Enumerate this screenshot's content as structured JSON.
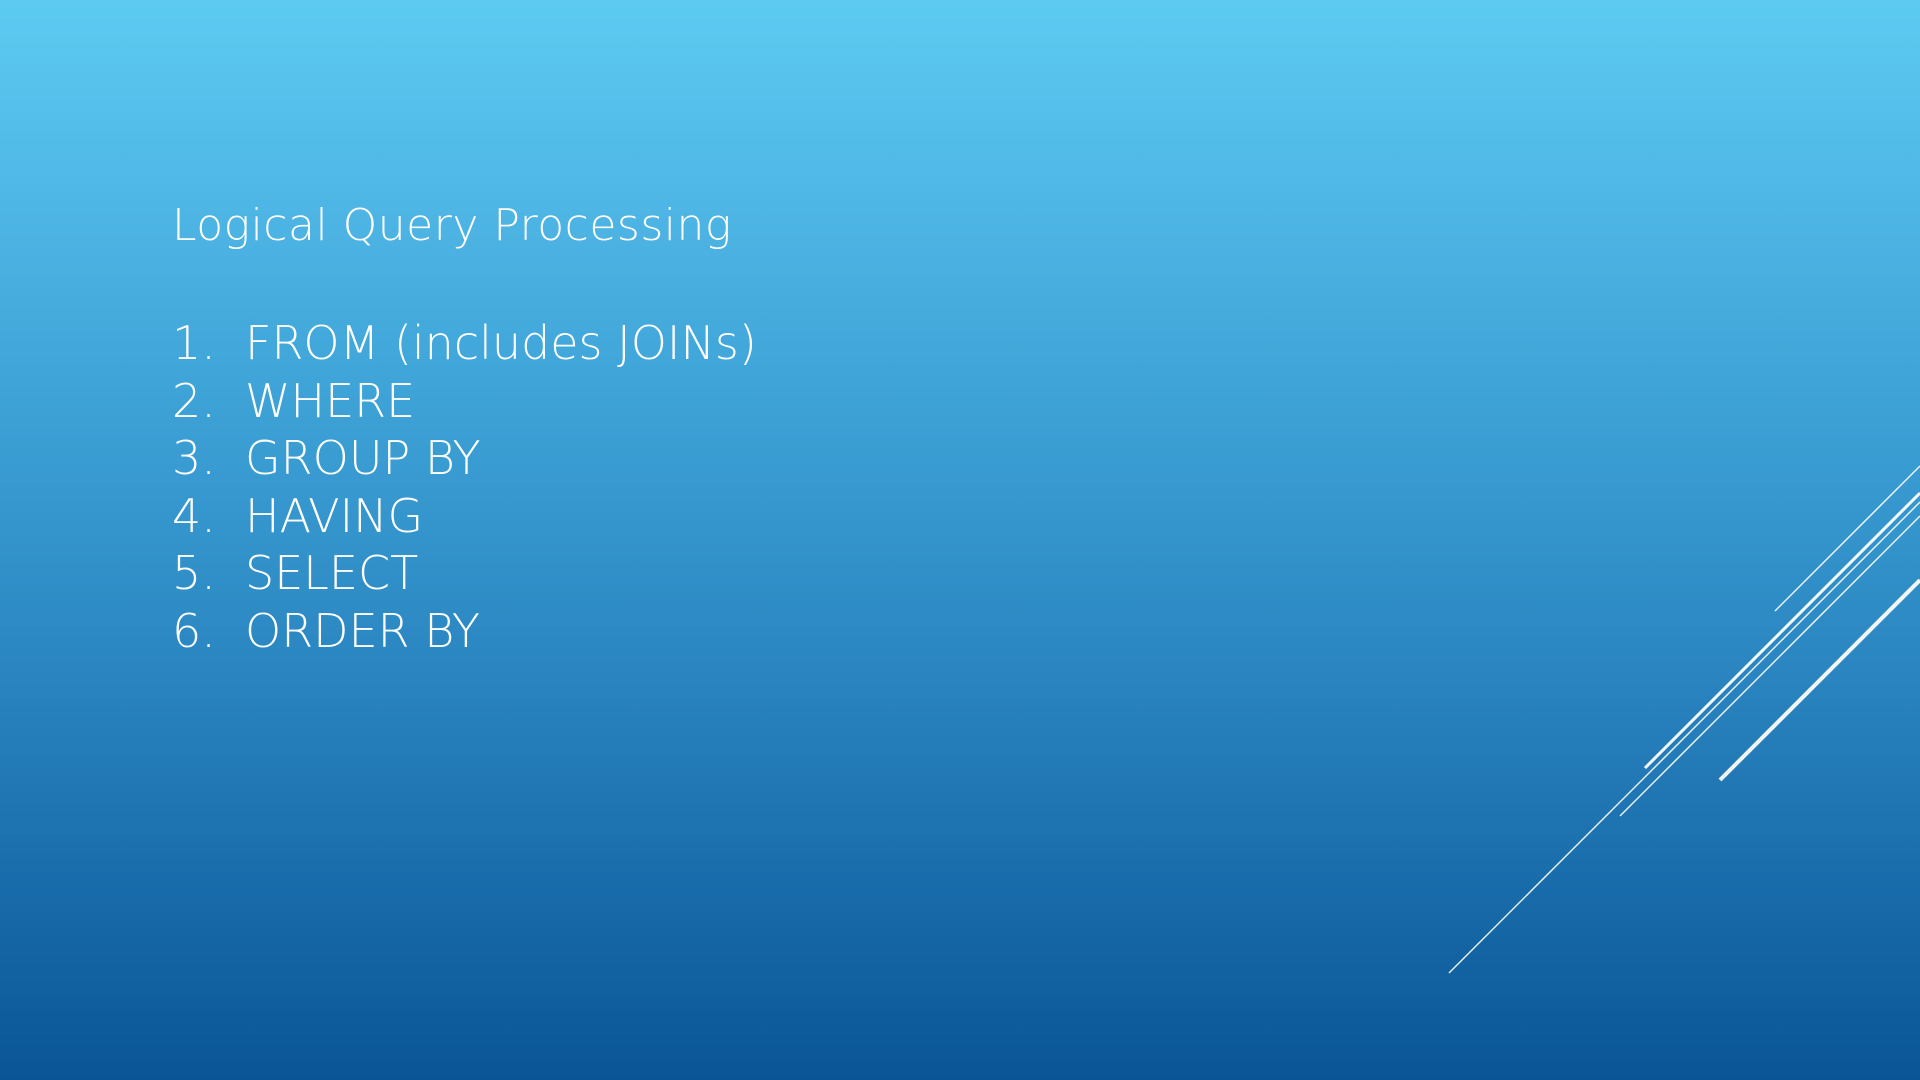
{
  "slide": {
    "title": "Logical Query Processing",
    "steps": [
      {
        "num": "1.",
        "text": "FROM (includes JOINs)"
      },
      {
        "num": "2.",
        "text": "WHERE"
      },
      {
        "num": "3.",
        "text": "GROUP BY"
      },
      {
        "num": "4.",
        "text": "HAVING"
      },
      {
        "num": "5.",
        "text": "SELECT"
      },
      {
        "num": "6.",
        "text": "ORDER BY"
      }
    ]
  },
  "theme": {
    "background_top": "#5ccbf1",
    "background_bottom": "#0a5595",
    "text_color": "#ffffff",
    "decoration_color": "#ffffff"
  }
}
